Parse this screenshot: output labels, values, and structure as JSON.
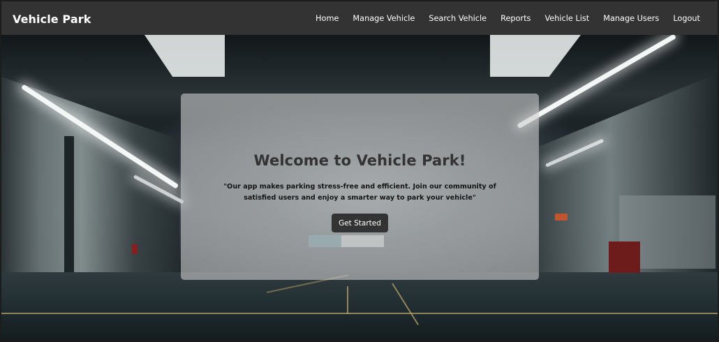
{
  "brand": {
    "title": "Vehicle Park"
  },
  "nav": {
    "items": [
      {
        "label": "Home"
      },
      {
        "label": "Manage Vehicle"
      },
      {
        "label": "Search Vehicle"
      },
      {
        "label": "Reports"
      },
      {
        "label": "Vehicle List"
      },
      {
        "label": "Manage Users"
      },
      {
        "label": "Logout"
      }
    ]
  },
  "hero": {
    "title": "Welcome to Vehicle Park!",
    "tagline": "\"Our app makes parking stress-free and efficient. Join our community of satisfied users and enjoy a smarter way to park your vehicle\"",
    "cta_label": "Get Started"
  },
  "colors": {
    "navbar_bg": "#333333",
    "button_bg": "#333333",
    "card_bg": "rgba(205,205,205,0.6)",
    "title_text": "#333333"
  },
  "icons": {
    "background": "parking-garage-image"
  }
}
